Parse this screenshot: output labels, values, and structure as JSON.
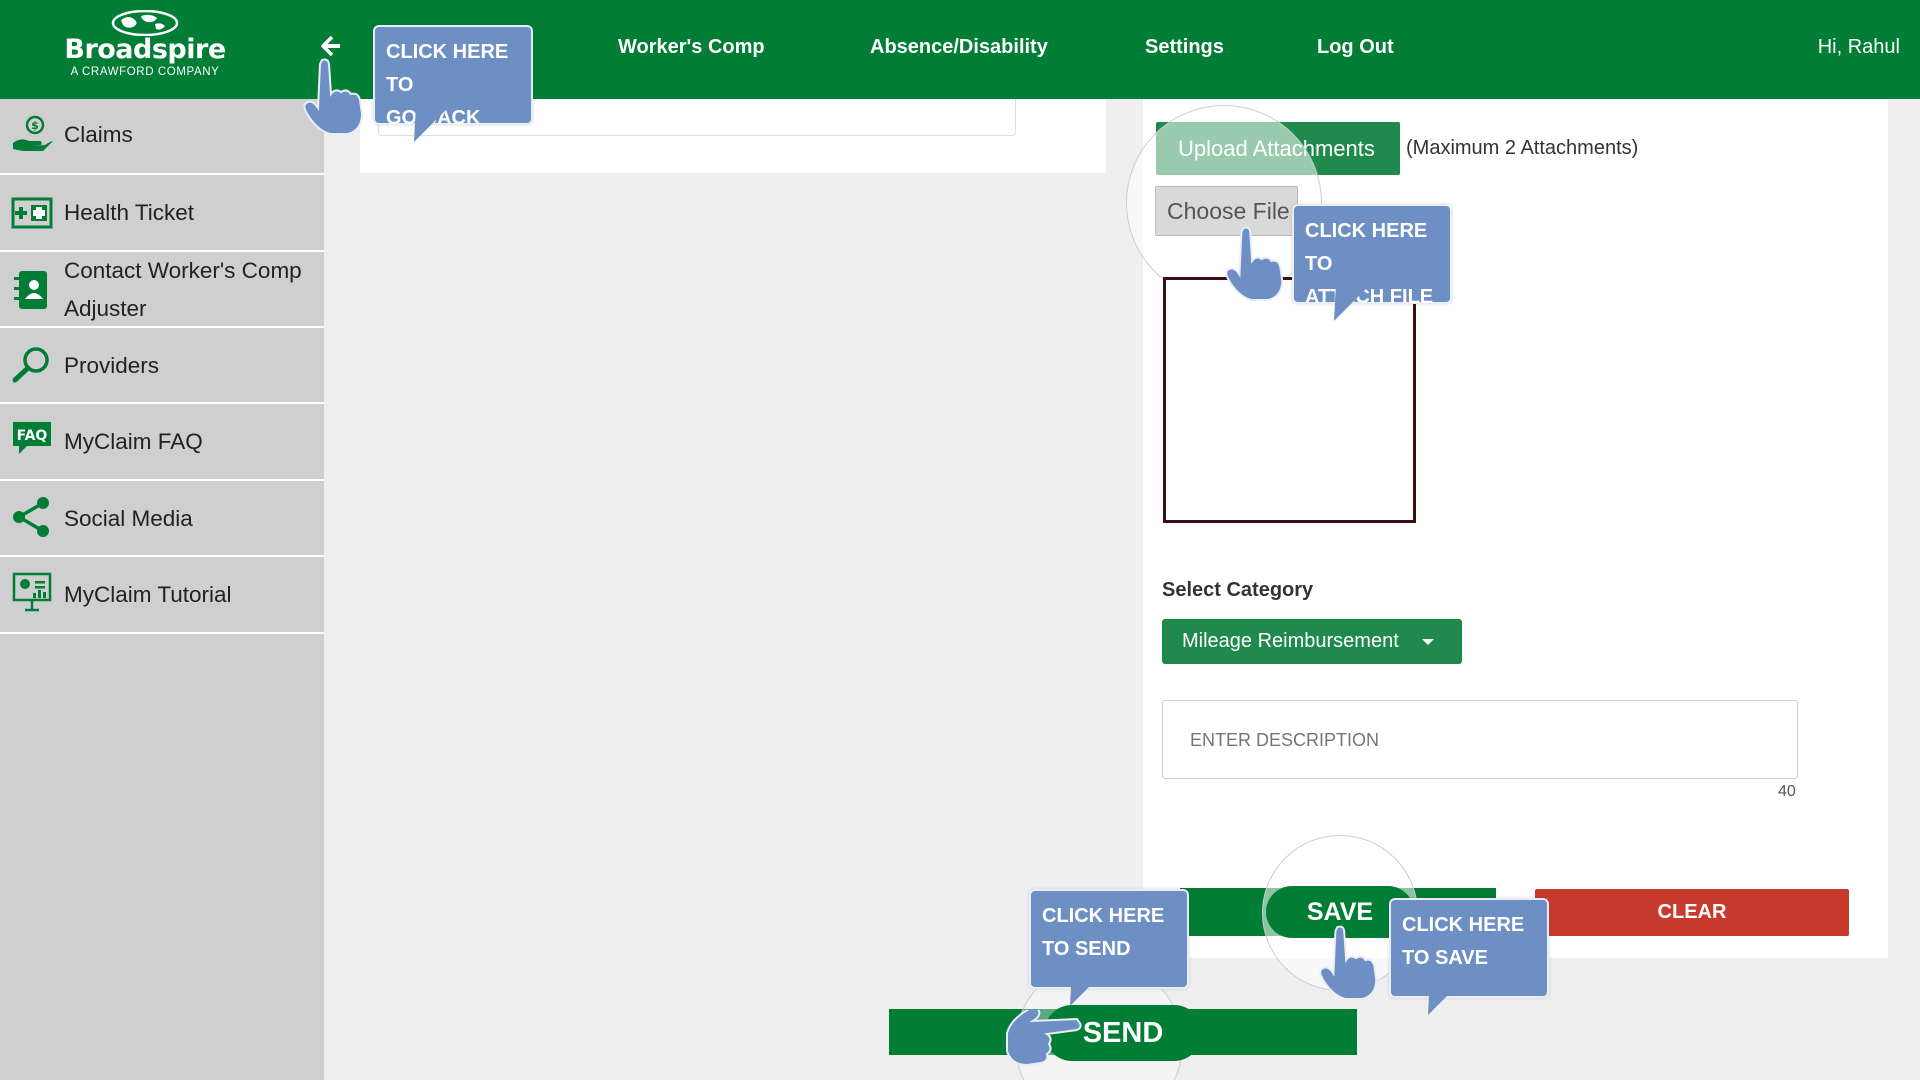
{
  "header": {
    "logo_brand": "Broadspire",
    "logo_sub": "A CRAWFORD COMPANY",
    "nav": [
      "Worker's Comp",
      "Absence/Disability",
      "Settings",
      "Log Out"
    ],
    "greeting": "Hi, Rahul"
  },
  "sidebar": {
    "items": [
      {
        "label": "Claims",
        "icon": "hand-dollar-icon"
      },
      {
        "label": "Health Ticket",
        "icon": "health-ticket-icon"
      },
      {
        "label": "Contact Worker's Comp Adjuster",
        "icon": "contact-book-icon"
      },
      {
        "label": "Providers",
        "icon": "magnifier-icon"
      },
      {
        "label": "MyClaim FAQ",
        "icon": "faq-icon"
      },
      {
        "label": "Social Media",
        "icon": "share-icon"
      },
      {
        "label": "MyClaim Tutorial",
        "icon": "presentation-icon"
      }
    ]
  },
  "attachments": {
    "upload_label": "Upload Attachments",
    "max_note": "(Maximum 2 Attachments)",
    "choose_file_label": "Choose File"
  },
  "category": {
    "label": "Select Category",
    "selected": "Mileage Reimbursement"
  },
  "description": {
    "placeholder": "ENTER DESCRIPTION",
    "char_count": "40"
  },
  "actions": {
    "save_label": "SAVE",
    "clear_label": "CLEAR",
    "send_label": "SEND"
  },
  "callouts": {
    "go_back": [
      "CLICK HERE TO",
      "GO BACK"
    ],
    "attach_file": [
      "CLICK HERE TO",
      "ATTACH  FILE"
    ],
    "send": [
      "CLICK HERE",
      "TO SEND"
    ],
    "save": [
      "CLICK HERE",
      "TO SAVE"
    ]
  },
  "colors": {
    "brand_green": "#017d36",
    "button_green": "#1f8a4c",
    "clear_red": "#c93a2e",
    "callout_blue": "#6d8fc3",
    "sidebar_gray": "#cfcfcf"
  }
}
